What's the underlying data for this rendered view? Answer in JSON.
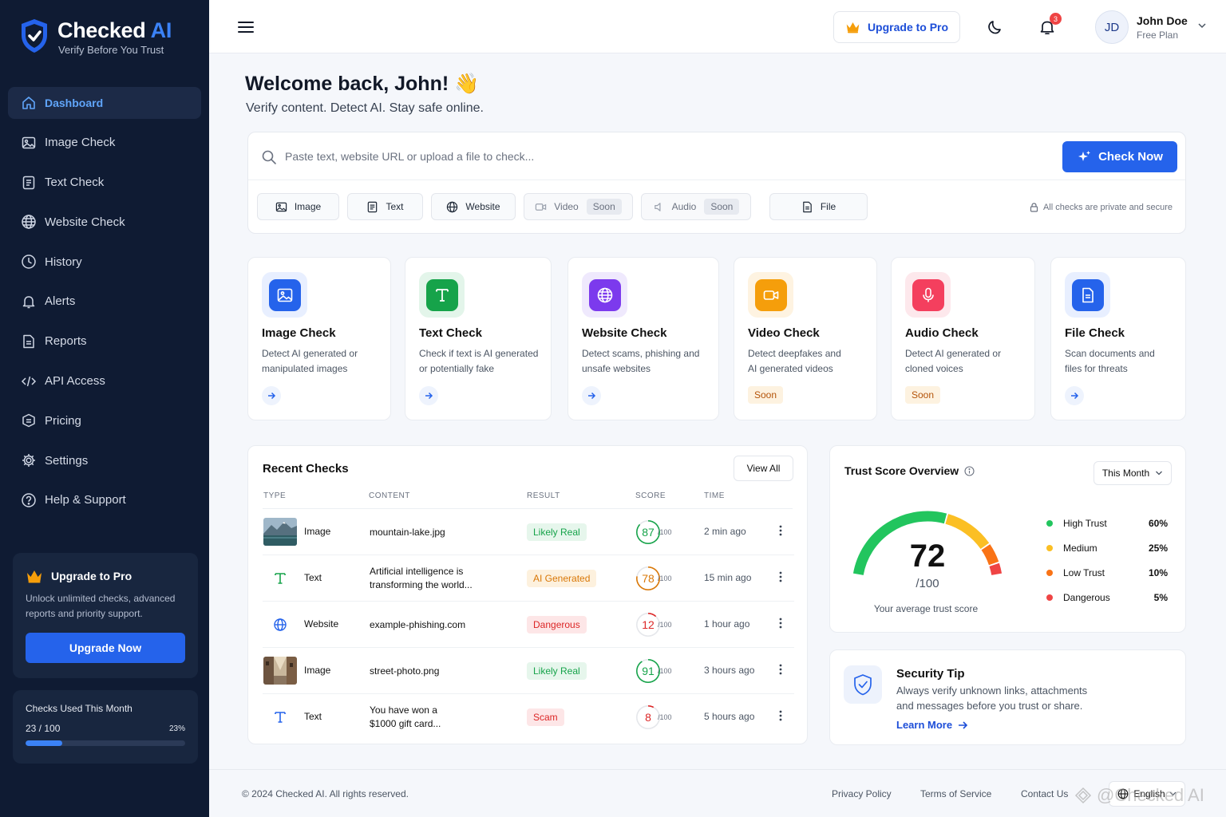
{
  "brand": {
    "name_main": "Checked",
    "name_accent": "AI",
    "tagline": "Verify Before You Trust"
  },
  "sidebar": {
    "items": [
      {
        "label": "Dashboard",
        "icon": "home-icon",
        "active": true
      },
      {
        "label": "Image Check",
        "icon": "image-icon"
      },
      {
        "label": "Text Check",
        "icon": "document-icon"
      },
      {
        "label": "Website Check",
        "icon": "globe-icon"
      },
      {
        "label": "History",
        "icon": "clock-icon"
      },
      {
        "label": "Alerts",
        "icon": "bell-icon"
      },
      {
        "label": "Reports",
        "icon": "report-icon"
      },
      {
        "label": "API Access",
        "icon": "api-icon"
      },
      {
        "label": "Pricing",
        "icon": "tag-icon"
      },
      {
        "label": "Settings",
        "icon": "gear-icon"
      },
      {
        "label": "Help & Support",
        "icon": "help-icon"
      }
    ],
    "promo": {
      "title": "Upgrade to Pro",
      "text": "Unlock unlimited checks, advanced reports and priority support.",
      "button": "Upgrade Now"
    },
    "usage": {
      "label": "Checks Used This Month",
      "count": "23 / 100",
      "percent_label": "23%",
      "fraction": 0.23
    }
  },
  "header": {
    "upgrade_label": "Upgrade to Pro",
    "notification_count": "3",
    "avatar_initials": "JD",
    "user_name": "John Doe",
    "user_plan": "Free Plan"
  },
  "welcome": {
    "title": "Welcome back, John! 👋",
    "subtitle": "Verify content. Detect AI. Stay safe online."
  },
  "search": {
    "placeholder": "Paste text, website URL or upload a file to check...",
    "button": "Check Now",
    "types": [
      {
        "label": "Image",
        "icon": "image-icon"
      },
      {
        "label": "Text",
        "icon": "document-icon"
      },
      {
        "label": "Website",
        "icon": "globe-icon"
      },
      {
        "label": "Video",
        "icon": "video-icon",
        "tag": "Soon"
      },
      {
        "label": "Audio",
        "icon": "audio-icon",
        "tag": "Soon"
      },
      {
        "label": "File",
        "icon": "file-icon"
      }
    ],
    "secure_note": "All checks are private and secure"
  },
  "features": [
    {
      "title": "Image Check",
      "desc": "Detect AI generated or manipulated images",
      "color": "#2563eb",
      "bg": "#e8efff"
    },
    {
      "title": "Text Check",
      "desc": "Check if text is AI generated or potentially fake",
      "color": "#16a34a",
      "bg": "#e3f5ea"
    },
    {
      "title": "Website Check",
      "desc": "Detect scams, phishing and unsafe websites",
      "color": "#7c3aed",
      "bg": "#efe9fd"
    },
    {
      "title": "Video Check",
      "desc": "Detect deepfakes and AI generated videos",
      "color": "#f59e0b",
      "bg": "#fef3e1",
      "tag": "Soon"
    },
    {
      "title": "Audio Check",
      "desc": "Detect AI generated or cloned voices",
      "color": "#f43f5e",
      "bg": "#fde8ec",
      "tag": "Soon"
    },
    {
      "title": "File Check",
      "desc": "Scan documents and files for threats",
      "color": "#2563eb",
      "bg": "#e8efff"
    }
  ],
  "recent": {
    "title": "Recent Checks",
    "view_all": "View All",
    "columns": [
      "TYPE",
      "CONTENT",
      "RESULT",
      "SCORE",
      "TIME"
    ],
    "score_suffix": "/100",
    "rows": [
      {
        "type": "Image",
        "content": "mountain-lake.jpg",
        "result": "Likely Real",
        "score": "87",
        "time": "2 min ago",
        "status": "real"
      },
      {
        "type": "Text",
        "content": "Artificial intelligence is transforming the world...",
        "result": "AI Generated",
        "score": "78",
        "time": "15 min ago",
        "status": "ai"
      },
      {
        "type": "Website",
        "content": "example-phishing.com",
        "result": "Dangerous",
        "score": "12",
        "time": "1 hour ago",
        "status": "danger"
      },
      {
        "type": "Image",
        "content": "street-photo.png",
        "result": "Likely Real",
        "score": "91",
        "time": "3 hours ago",
        "status": "real"
      },
      {
        "type": "Text",
        "content": "You have won a $1000 gift card...",
        "result": "Scam",
        "score": "8",
        "time": "5 hours ago",
        "status": "danger"
      }
    ],
    "status_colors": {
      "real": "#16a34a",
      "ai": "#d97706",
      "danger": "#dc2626"
    }
  },
  "trust": {
    "title": "Trust Score Overview",
    "period": "This Month",
    "score": "72",
    "max_label": "/100",
    "caption": "Your average trust score",
    "legend": [
      {
        "label": "High Trust",
        "value": "60%",
        "color": "#22c55e"
      },
      {
        "label": "Medium",
        "value": "25%",
        "color": "#fbbf24"
      },
      {
        "label": "Low Trust",
        "value": "10%",
        "color": "#f97316"
      },
      {
        "label": "Dangerous",
        "value": "5%",
        "color": "#ef4444"
      }
    ]
  },
  "tip": {
    "title": "Security Tip",
    "text": "Always verify unknown links, attachments and messages before you trust or share.",
    "link": "Learn More"
  },
  "footer": {
    "copyright": "© 2024 Checked AI. All rights reserved.",
    "links": [
      "Privacy Policy",
      "Terms of Service",
      "Contact Us"
    ],
    "language": "English",
    "watermark": "@Checked AI"
  }
}
